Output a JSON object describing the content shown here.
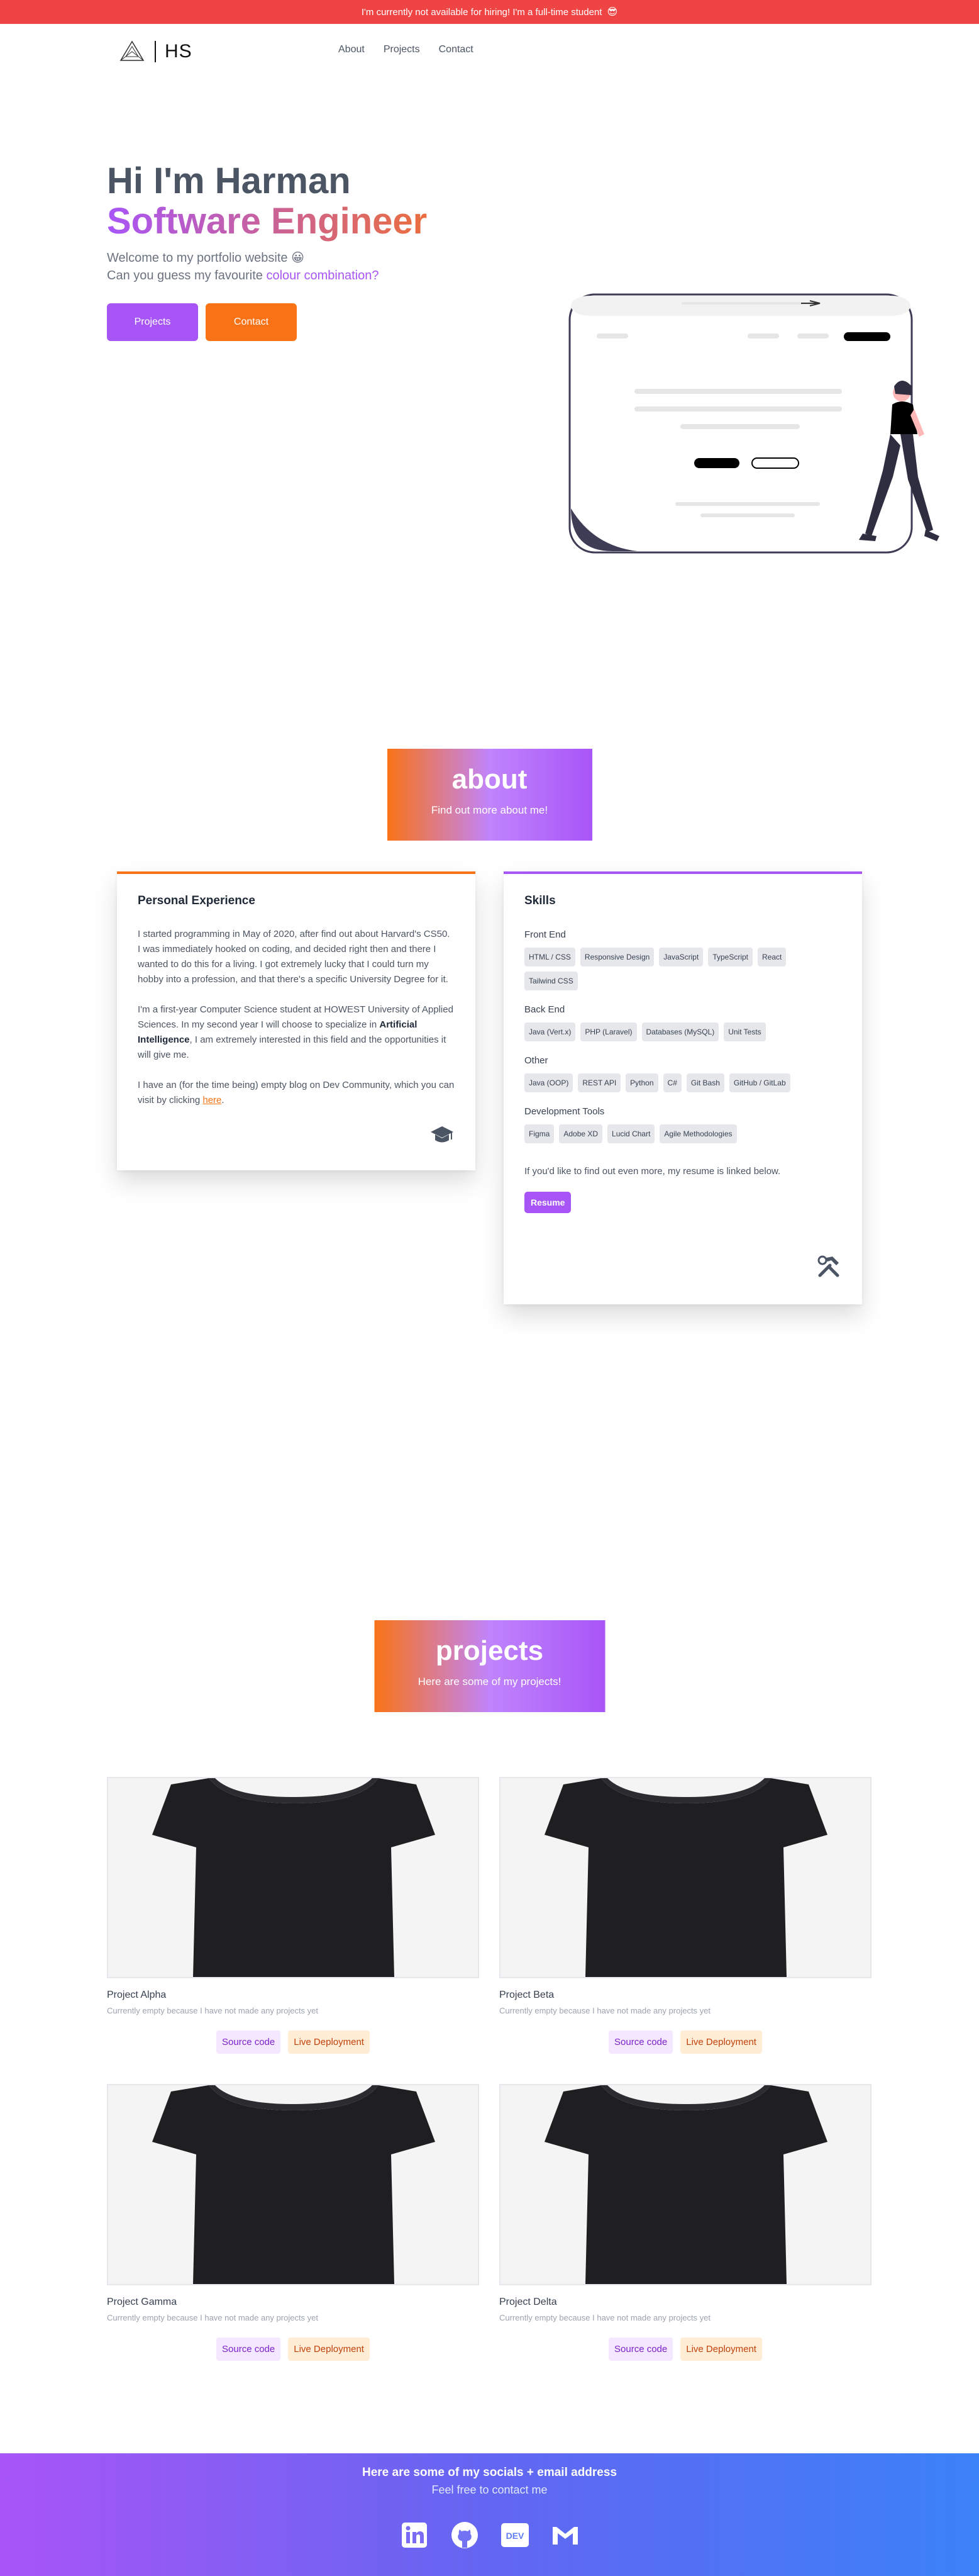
{
  "banner": {
    "text": "I'm currently not available for hiring! I'm a full-time student",
    "icon": "sunglasses-icon"
  },
  "nav": {
    "initials": "HS",
    "links": [
      "About",
      "Projects",
      "Contact"
    ]
  },
  "hero": {
    "greeting": "Hi I'm Harman",
    "role": "Software Engineer",
    "welcome": "Welcome to my portfolio website",
    "welcome_emoji": "😀",
    "colour_prefix": "Can you guess my favourite ",
    "colour_accent": "colour combination?",
    "buttons": {
      "projects": "Projects",
      "contact": "Contact"
    }
  },
  "about": {
    "title": "about",
    "subtitle": "Find out more about me!",
    "experience": {
      "title": "Personal Experience",
      "p1": "I started programming in May of 2020, after find out about Harvard's CS50. I was immediately hooked on coding, and decided right then and there I wanted to do this for a living. I got extremely lucky that I could turn my hobby into a profession, and that there's a specific University Degree for it.",
      "p2_before": "I'm a first-year Computer Science student at HOWEST University of Applied Sciences. In my second year I will choose to specialize in ",
      "p2_bold": "Artificial Intelligence",
      "p2_after": ", I am extremely interested in this field and the opportunities it will give me.",
      "p3_before": "I have an (for the time being) empty blog on Dev Community, which you can visit by clicking ",
      "p3_link": "here",
      "p3_after": "."
    },
    "skills": {
      "title": "Skills",
      "groups": [
        {
          "name": "Front End",
          "items": [
            "HTML / CSS",
            "Responsive Design",
            "JavaScript",
            "TypeScript",
            "React",
            "Tailwind CSS"
          ]
        },
        {
          "name": "Back End",
          "items": [
            "Java (Vert.x)",
            "PHP (Laravel)",
            "Databases (MySQL)",
            "Unit Tests"
          ]
        },
        {
          "name": "Other",
          "items": [
            "Java (OOP)",
            "REST API",
            "Python",
            "C#",
            "Git Bash",
            "GitHub / GitLab"
          ]
        },
        {
          "name": "Development Tools",
          "items": [
            "Figma",
            "Adobe XD",
            "Lucid Chart",
            "Agile Methodologies"
          ]
        }
      ],
      "note": "If you'd like to find out even more, my resume is linked below.",
      "resume": "Resume"
    }
  },
  "projects": {
    "title": "projects",
    "subtitle": "Here are some of my projects!",
    "items": [
      {
        "name": "Project Alpha",
        "desc": "Currently empty because I have not made any projects yet",
        "source": "Source code",
        "live": "Live Deployment"
      },
      {
        "name": "Project Beta",
        "desc": "Currently empty because I have not made any projects yet",
        "source": "Source code",
        "live": "Live Deployment"
      },
      {
        "name": "Project Gamma",
        "desc": "Currently empty because I have not made any projects yet",
        "source": "Source code",
        "live": "Live Deployment"
      },
      {
        "name": "Project Delta",
        "desc": "Currently empty because I have not made any projects yet",
        "source": "Source code",
        "live": "Live Deployment"
      }
    ]
  },
  "footer": {
    "title": "Here are some of my socials + email address",
    "subtitle": "Feel free to contact me",
    "socials": [
      {
        "name": "linkedin-icon",
        "label": "in"
      },
      {
        "name": "github-icon",
        "label": ""
      },
      {
        "name": "dev-icon",
        "label": "DEV"
      },
      {
        "name": "gmail-icon",
        "label": "M"
      }
    ]
  },
  "colors": {
    "purple": "#a855f7",
    "orange": "#f97316",
    "red": "#ef4444",
    "blue": "#3b82f6"
  }
}
